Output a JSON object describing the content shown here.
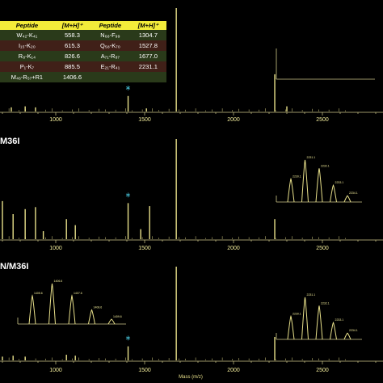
{
  "table": {
    "headers": [
      "Peptide",
      "[M+H]⁺",
      "Peptide",
      "[M+H]⁺"
    ],
    "rows": [
      [
        "W₄₂-K₄₁",
        "558.3",
        "N₆₈-F₉₉",
        "1304.7"
      ],
      [
        "I₁₅-K₂₀",
        "615.3",
        "Q₅₈-K₇₀",
        "1527.8"
      ],
      [
        "R₈-K₁₄",
        "826.6",
        "A₇₁-R₈₇",
        "1677.0"
      ],
      [
        "P₁-K₇",
        "885.5",
        "E₂₁-R₄₁",
        "2231.1"
      ],
      [
        "M₄₆-R₅₇+R1",
        "1406.6",
        "",
        ""
      ]
    ]
  },
  "colors": {
    "spectrum": "#e8e08a",
    "axis": "#cfc98a",
    "star": "#4fd8f0",
    "text": "#ffffff",
    "tick_text": "#f2ec9a"
  },
  "chart_data": [
    {
      "type": "line",
      "panel_label": "",
      "xlabel": "",
      "xlim": [
        650,
        2800
      ],
      "x_ticks": [
        "1000",
        "1500",
        "2000",
        "2500"
      ],
      "marked_peak": {
        "x": 1407,
        "marker": "*"
      },
      "peaks": [
        {
          "x": 560,
          "y": 0.06
        },
        {
          "x": 617,
          "y": 0.05
        },
        {
          "x": 750,
          "y": 0.04
        },
        {
          "x": 828,
          "y": 0.05
        },
        {
          "x": 886,
          "y": 0.04
        },
        {
          "x": 1407,
          "y": 0.15
        },
        {
          "x": 1510,
          "y": 0.03
        },
        {
          "x": 1678,
          "y": 1.0
        },
        {
          "x": 2232,
          "y": 0.36
        },
        {
          "x": 2300,
          "y": 0.05
        }
      ],
      "inset": {
        "labels": []
      }
    },
    {
      "type": "line",
      "panel_label": "M36I",
      "xlabel": "",
      "xlim": [
        650,
        2800
      ],
      "x_ticks": [
        "1000",
        "1500",
        "2000",
        "2500"
      ],
      "marked_peak": {
        "x": 1407,
        "marker": "*"
      },
      "peaks": [
        {
          "x": 560,
          "y": 0.1
        },
        {
          "x": 617,
          "y": 0.12
        },
        {
          "x": 700,
          "y": 0.38
        },
        {
          "x": 760,
          "y": 0.25
        },
        {
          "x": 828,
          "y": 0.3
        },
        {
          "x": 886,
          "y": 0.32
        },
        {
          "x": 930,
          "y": 0.08
        },
        {
          "x": 1060,
          "y": 0.2
        },
        {
          "x": 1110,
          "y": 0.14
        },
        {
          "x": 1407,
          "y": 0.36
        },
        {
          "x": 1478,
          "y": 0.1
        },
        {
          "x": 1528,
          "y": 0.33
        },
        {
          "x": 1678,
          "y": 1.0
        },
        {
          "x": 2232,
          "y": 0.2
        }
      ],
      "inset": {
        "labels": [
          "2230.1",
          "2231.1",
          "2232.1",
          "2233.1",
          "2234.1"
        ],
        "values": [
          0.55,
          1.0,
          0.8,
          0.4,
          0.15
        ]
      }
    },
    {
      "type": "line",
      "panel_label": "N/M36I",
      "xlabel": "Mass (m/z)",
      "xlim": [
        650,
        2800
      ],
      "x_ticks": [
        "1000",
        "1500",
        "2000",
        "2500"
      ],
      "marked_peak": {
        "x": 1407,
        "marker": "*"
      },
      "peaks": [
        {
          "x": 560,
          "y": 0.05
        },
        {
          "x": 617,
          "y": 0.06
        },
        {
          "x": 700,
          "y": 0.04
        },
        {
          "x": 760,
          "y": 0.05
        },
        {
          "x": 828,
          "y": 0.04
        },
        {
          "x": 1060,
          "y": 0.06
        },
        {
          "x": 1110,
          "y": 0.05
        },
        {
          "x": 1407,
          "y": 0.15
        },
        {
          "x": 1678,
          "y": 1.0
        },
        {
          "x": 2232,
          "y": 0.25
        }
      ],
      "inset": {
        "labels": [
          "1405.6",
          "1406.6",
          "1407.6",
          "1408.6",
          "1409.6"
        ],
        "values": [
          0.7,
          1.0,
          0.7,
          0.35,
          0.12
        ]
      },
      "inset2": {
        "labels": [
          "2230.1",
          "2231.1",
          "2232.1",
          "2233.1",
          "2234.1"
        ],
        "values": [
          0.55,
          1.0,
          0.8,
          0.4,
          0.15
        ]
      }
    }
  ]
}
